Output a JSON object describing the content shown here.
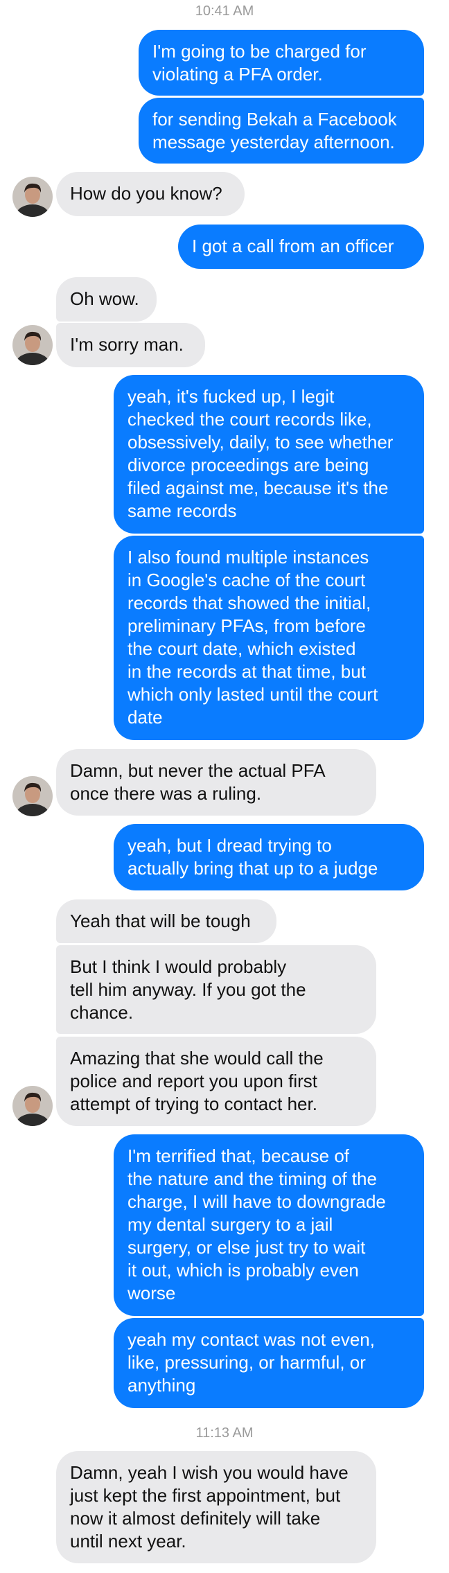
{
  "timestamps": [
    "10:41 AM",
    "11:13 AM"
  ],
  "messages": [
    {
      "text": "I'm going to be charged for\nviolating a PFA order."
    },
    {
      "text": "for sending Bekah a Facebook\nmessage yesterday afternoon."
    },
    {
      "text": "How do you know?"
    },
    {
      "text": "I got a call from an officer"
    },
    {
      "text": "Oh wow."
    },
    {
      "text": "I'm sorry man."
    },
    {
      "text": "yeah, it's fucked up, I legit\nchecked the court records like,\nobsessively, daily, to see whether\ndivorce proceedings are being\nfiled against me, because it's the\nsame records"
    },
    {
      "text": "I also found multiple instances\nin Google's cache of the court\nrecords that showed the initial,\npreliminary PFAs, from before\nthe court date, which existed\nin the records at that time, but\nwhich only lasted until the court\ndate"
    },
    {
      "text": "Damn, but never the actual PFA\nonce there was a ruling."
    },
    {
      "text": "yeah, but I dread trying to\nactually bring that up to a judge"
    },
    {
      "text": "Yeah that will be tough"
    },
    {
      "text": "But I think I would probably\ntell him anyway. If you got the\nchance."
    },
    {
      "text": "Amazing that she would call the\npolice and report you upon first\nattempt of trying to contact her."
    },
    {
      "text": "I'm terrified that, because of\nthe nature and the timing of the\ncharge, I will have to downgrade\nmy dental surgery to a jail\nsurgery, or else just try to wait\nit out, which is probably even\nworse"
    },
    {
      "text": "yeah my contact was not even,\nlike, pressuring, or harmful, or\nanything"
    },
    {
      "text": "Damn, yeah I wish you would have\njust kept the first appointment, but\nnow it almost definitely will take\nuntil next year."
    }
  ],
  "colors": {
    "outgoing_bubble": "#0A7CFF",
    "incoming_bubble": "#E9E9EB",
    "timestamp_text": "#9A9A9A"
  },
  "icons": {
    "contact_avatar": "contact-avatar-photo"
  }
}
